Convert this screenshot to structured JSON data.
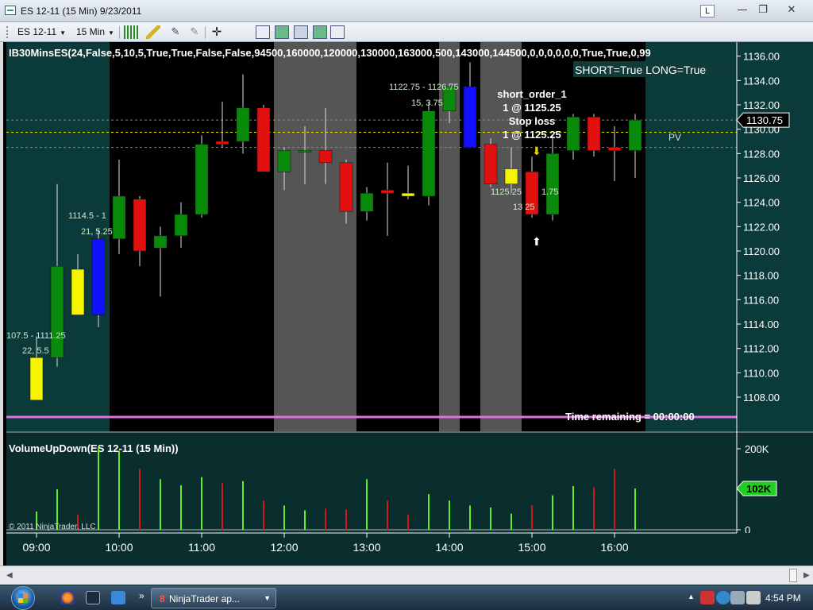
{
  "window": {
    "title": "ES 12-11 (15 Min)  9/23/2011",
    "badge": "L",
    "minimize": "—",
    "restore": "❐",
    "close": "✕"
  },
  "toolbar": {
    "instrument": "ES 12-11",
    "interval": "15 Min"
  },
  "indicator_label": "IB30MinsES(24,False,5,10,5,True,True,False,False,94500,160000,120000,130000,163000,500,143000,144500,0,0,0,0,0,0,True,True,0,99",
  "status_box": "SHORT=True LONG=True",
  "pv_label": "PV",
  "time_remaining": "Time remaining = 00:00:00",
  "order_annotation": {
    "name": "short_order_1",
    "qty_price": "1 @ 1125.25",
    "stop_title": "Stop loss",
    "stop_price": "1 @ 1125.25"
  },
  "chart_texts": {
    "range1": "1122.75 - 1126.75",
    "sub1": "15, 3.75",
    "range2": "1114.5 - 1",
    "sub2": "21, 5.25",
    "range3": "107.5 - 1111.25",
    "sub3": "22, 5.5",
    "fill_left": "1125.25",
    "fill_right": "1.75",
    "fill_sub": "13 25"
  },
  "volume_title": "VolumeUpDown(ES 12-11 (15 Min))",
  "copyright": "© 2011 NinjaTrader, LLC",
  "current_price": "1130.75",
  "current_volume": "102K",
  "taskbar": {
    "app_label": "NinjaTrader ap...",
    "count": "8",
    "chevron": "»",
    "clock": "4:54 PM",
    "tray_arrow": "▲"
  },
  "colors": {
    "up": "#0a8a0a",
    "down": "#e31010",
    "blue": "#1010ff",
    "yellow": "#f5f500",
    "background": "#000000",
    "outside_session": "#0a3a3a",
    "grey_zone": "#555555",
    "magenta_line": "#e070e0",
    "yellow_line": "#e8e800"
  },
  "chart_data": [
    {
      "type": "candlestick",
      "title": "ES 12-11 (15 Min)",
      "x_ticks": [
        "09:00",
        "10:00",
        "11:00",
        "12:00",
        "13:00",
        "14:00",
        "15:00",
        "16:00"
      ],
      "y_ticks": [
        1108,
        1110,
        1112,
        1114,
        1116,
        1118,
        1120,
        1122,
        1124,
        1126,
        1128,
        1130,
        1132,
        1134,
        1136
      ],
      "y_tick_labels": [
        "1108.00",
        "1110.00",
        "1112.00",
        "1114.00",
        "1116.00",
        "1118.00",
        "1120.00",
        "1122.00",
        "1124.00",
        "1126.00",
        "1128.00",
        "1130.00",
        "1132.00",
        "1134.00",
        "1136.00"
      ],
      "ylim": [
        1106.5,
        1136.5
      ],
      "horizontal_lines": [
        1130.75,
        1129.75,
        1128.5
      ],
      "bars": [
        {
          "t": "09:00",
          "o": 1107.75,
          "h": 1113.0,
          "l": 1107.75,
          "c": 1111.25,
          "color": "yellow"
        },
        {
          "t": "09:15",
          "o": 1111.25,
          "h": 1125.5,
          "l": 1110.5,
          "c": 1118.75,
          "color": "green"
        },
        {
          "t": "09:30",
          "o": 1118.5,
          "h": 1119.75,
          "l": 1114.75,
          "c": 1114.75,
          "color": "yellow"
        },
        {
          "t": "09:45",
          "o": 1114.75,
          "h": 1121.75,
          "l": 1113.75,
          "c": 1121.0,
          "color": "blue"
        },
        {
          "t": "10:00",
          "o": 1121.0,
          "h": 1127.5,
          "l": 1119.75,
          "c": 1124.5,
          "color": "green"
        },
        {
          "t": "10:15",
          "o": 1124.25,
          "h": 1124.5,
          "l": 1118.75,
          "c": 1120.0,
          "color": "red"
        },
        {
          "t": "10:30",
          "o": 1120.25,
          "h": 1122.0,
          "l": 1116.25,
          "c": 1121.25,
          "color": "green"
        },
        {
          "t": "10:45",
          "o": 1121.25,
          "h": 1124.0,
          "l": 1120.25,
          "c": 1123.0,
          "color": "green"
        },
        {
          "t": "11:00",
          "o": 1123.0,
          "h": 1129.5,
          "l": 1122.75,
          "c": 1128.75,
          "color": "green"
        },
        {
          "t": "11:15",
          "o": 1129.0,
          "h": 1132.25,
          "l": 1128.5,
          "c": 1128.75,
          "color": "red"
        },
        {
          "t": "11:30",
          "o": 1129.0,
          "h": 1134.5,
          "l": 1128.0,
          "c": 1131.75,
          "color": "green"
        },
        {
          "t": "11:45",
          "o": 1131.75,
          "h": 1132.0,
          "l": 1126.5,
          "c": 1126.5,
          "color": "red"
        },
        {
          "t": "12:00",
          "o": 1126.5,
          "h": 1128.5,
          "l": 1125.0,
          "c": 1128.25,
          "color": "green"
        },
        {
          "t": "12:15",
          "o": 1128.25,
          "h": 1130.25,
          "l": 1125.5,
          "c": 1128.25,
          "color": "green"
        },
        {
          "t": "12:30",
          "o": 1128.25,
          "h": 1131.75,
          "l": 1125.5,
          "c": 1127.25,
          "color": "red"
        },
        {
          "t": "12:45",
          "o": 1127.25,
          "h": 1127.5,
          "l": 1122.25,
          "c": 1123.25,
          "color": "red"
        },
        {
          "t": "13:00",
          "o": 1123.25,
          "h": 1125.25,
          "l": 1122.5,
          "c": 1124.75,
          "color": "green"
        },
        {
          "t": "13:15",
          "o": 1125.0,
          "h": 1127.25,
          "l": 1121.25,
          "c": 1124.75,
          "color": "red"
        },
        {
          "t": "13:30",
          "o": 1124.75,
          "h": 1127.0,
          "l": 1124.25,
          "c": 1124.5,
          "color": "yellow"
        },
        {
          "t": "13:45",
          "o": 1124.5,
          "h": 1132.25,
          "l": 1123.75,
          "c": 1131.5,
          "color": "green"
        },
        {
          "t": "14:00",
          "o": 1131.5,
          "h": 1133.75,
          "l": 1130.5,
          "c": 1133.5,
          "color": "green"
        },
        {
          "t": "14:15",
          "o": 1133.5,
          "h": 1135.5,
          "l": 1128.5,
          "c": 1128.5,
          "color": "blue"
        },
        {
          "t": "14:30",
          "o": 1128.75,
          "h": 1129.25,
          "l": 1125.25,
          "c": 1125.5,
          "color": "red"
        },
        {
          "t": "14:45",
          "o": 1125.5,
          "h": 1128.5,
          "l": 1124.75,
          "c": 1126.75,
          "color": "yellow"
        },
        {
          "t": "15:00",
          "o": 1126.5,
          "h": 1127.75,
          "l": 1122.75,
          "c": 1123.0,
          "color": "red"
        },
        {
          "t": "15:15",
          "o": 1123.0,
          "h": 1129.5,
          "l": 1122.5,
          "c": 1128.0,
          "color": "green"
        },
        {
          "t": "15:30",
          "o": 1128.25,
          "h": 1131.25,
          "l": 1127.5,
          "c": 1131.0,
          "color": "green"
        },
        {
          "t": "15:45",
          "o": 1131.0,
          "h": 1131.25,
          "l": 1127.75,
          "c": 1128.25,
          "color": "red"
        },
        {
          "t": "16:00",
          "o": 1128.5,
          "h": 1130.25,
          "l": 1125.75,
          "c": 1128.25,
          "color": "red"
        },
        {
          "t": "16:15",
          "o": 1128.25,
          "h": 1131.25,
          "l": 1126.0,
          "c": 1130.75,
          "color": "green"
        }
      ]
    },
    {
      "type": "bar",
      "title": "VolumeUpDown(ES 12-11 (15 Min))",
      "y_ticks": [
        0,
        200
      ],
      "y_tick_labels": [
        "0",
        "200K"
      ],
      "unit": "K",
      "ylim": [
        0,
        200
      ],
      "categories": [
        "09:00",
        "09:15",
        "09:30",
        "09:45",
        "10:00",
        "10:15",
        "10:30",
        "10:45",
        "11:00",
        "11:15",
        "11:30",
        "11:45",
        "12:00",
        "12:15",
        "12:30",
        "12:45",
        "13:00",
        "13:15",
        "13:30",
        "13:45",
        "14:00",
        "14:15",
        "14:30",
        "14:45",
        "15:00",
        "15:15",
        "15:30",
        "15:45",
        "16:00",
        "16:15"
      ],
      "values": [
        45,
        100,
        38,
        220,
        195,
        150,
        125,
        110,
        130,
        115,
        120,
        72,
        60,
        48,
        52,
        50,
        125,
        72,
        38,
        88,
        72,
        60,
        55,
        40,
        60,
        85,
        108,
        105,
        150,
        102
      ],
      "value_colors": [
        "green",
        "green",
        "red",
        "green",
        "green",
        "red",
        "green",
        "green",
        "green",
        "red",
        "green",
        "red",
        "green",
        "green",
        "red",
        "red",
        "green",
        "red",
        "red",
        "green",
        "green",
        "green",
        "green",
        "green",
        "red",
        "green",
        "green",
        "red",
        "red",
        "green"
      ]
    }
  ]
}
